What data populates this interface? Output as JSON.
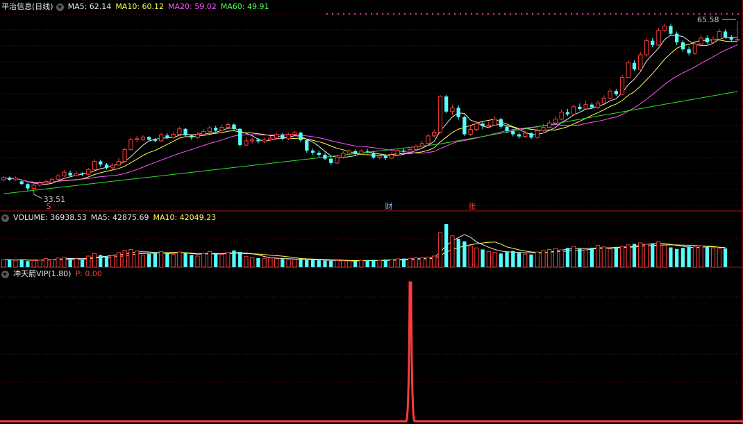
{
  "price_panel": {
    "title": "平治信息(日线)",
    "ma_labels": [
      {
        "text": "MA5: 62.14",
        "color": "#e8e8e8"
      },
      {
        "text": "MA10: 60.12",
        "color": "#ffff54"
      },
      {
        "text": "MA20: 59.02",
        "color": "#ff54ff"
      },
      {
        "text": "MA60: 49.91",
        "color": "#54ff54"
      }
    ],
    "high_label": "65.58",
    "low_label": "33.51",
    "markers": [
      {
        "text": "S",
        "color": "#ff3c3c"
      },
      {
        "text": "财",
        "color": "#8ab4ff"
      },
      {
        "text": "张",
        "color": "#ff3c3c"
      }
    ]
  },
  "volume_panel": {
    "labels": [
      {
        "text": "VOLUME: 36938.53",
        "color": "#e8e8e8"
      },
      {
        "text": "MA5: 42875.69",
        "color": "#e8e8e8"
      },
      {
        "text": "MA10: 42049.23",
        "color": "#ffff54"
      }
    ]
  },
  "indicator_panel": {
    "title": "冲天箭VIP(1.80)",
    "p_label": "P: 0.00",
    "p_color": "#ff3c3c"
  },
  "colors": {
    "up": "#ff3c3c",
    "down": "#54ffff",
    "ma5": "#e8e8e8",
    "ma10": "#ffff54",
    "ma20": "#ff54ff",
    "ma60": "#33dd33",
    "grid": "#7a1010",
    "border": "#b01010"
  },
  "chart_data": {
    "type": "candlestick",
    "y_range": [
      33.51,
      65.58
    ],
    "candles": [
      [
        36.2,
        36.6,
        36.9,
        35.9
      ],
      [
        36.6,
        36.2,
        36.8,
        36.0
      ],
      [
        36.2,
        36.5,
        36.8,
        36.0
      ],
      [
        35.9,
        35.4,
        36.1,
        35.2
      ],
      [
        35.4,
        34.6,
        35.6,
        34.2
      ],
      [
        34.6,
        35.2,
        35.5,
        33.5
      ],
      [
        35.2,
        35.6,
        36.0,
        34.9
      ],
      [
        35.6,
        35.9,
        36.2,
        35.3
      ],
      [
        35.7,
        36.3,
        36.5,
        35.5
      ],
      [
        36.3,
        36.9,
        37.3,
        36.0
      ],
      [
        36.9,
        37.6,
        38.0,
        36.7
      ],
      [
        37.5,
        37.0,
        37.9,
        36.7
      ],
      [
        37.0,
        37.4,
        37.8,
        36.8
      ],
      [
        37.4,
        37.2,
        37.6,
        36.9
      ],
      [
        37.2,
        38.1,
        38.4,
        37.0
      ],
      [
        38.1,
        39.6,
        40.0,
        37.9
      ],
      [
        39.6,
        39.0,
        39.9,
        38.6
      ],
      [
        39.0,
        38.4,
        39.3,
        38.1
      ],
      [
        38.4,
        38.9,
        39.2,
        38.1
      ],
      [
        38.9,
        39.6,
        40.2,
        38.8
      ],
      [
        39.6,
        41.8,
        42.1,
        39.4
      ],
      [
        41.8,
        43.6,
        44.0,
        41.6
      ],
      [
        43.6,
        43.8,
        44.3,
        43.2
      ],
      [
        43.6,
        44.1,
        44.4,
        43.4
      ],
      [
        44.1,
        43.6,
        44.3,
        43.3
      ],
      [
        43.6,
        43.4,
        43.9,
        43.1
      ],
      [
        43.4,
        44.5,
        44.9,
        43.2
      ],
      [
        44.4,
        44.0,
        44.8,
        43.7
      ],
      [
        44.0,
        44.6,
        45.0,
        43.8
      ],
      [
        44.6,
        45.6,
        46.0,
        44.4
      ],
      [
        45.6,
        44.4,
        45.8,
        44.2
      ],
      [
        44.4,
        44.0,
        44.6,
        43.6
      ],
      [
        44.0,
        44.6,
        45.0,
        43.8
      ],
      [
        44.6,
        45.1,
        45.6,
        44.3
      ],
      [
        45.1,
        45.8,
        46.2,
        44.9
      ],
      [
        45.8,
        45.3,
        46.2,
        45.0
      ],
      [
        45.3,
        45.9,
        46.4,
        45.1
      ],
      [
        45.9,
        46.4,
        46.8,
        45.6
      ],
      [
        46.4,
        45.6,
        46.6,
        45.3
      ],
      [
        45.6,
        42.6,
        45.8,
        42.3
      ],
      [
        42.6,
        43.4,
        44.1,
        42.4
      ],
      [
        43.4,
        43.6,
        44.0,
        42.9
      ],
      [
        43.6,
        43.3,
        43.9,
        42.9
      ],
      [
        43.3,
        43.6,
        44.0,
        43.0
      ],
      [
        43.6,
        43.9,
        44.3,
        43.3
      ],
      [
        43.9,
        44.5,
        45.0,
        43.6
      ],
      [
        44.5,
        43.8,
        44.8,
        43.5
      ],
      [
        43.8,
        44.6,
        44.9,
        43.5
      ],
      [
        44.6,
        44.9,
        45.3,
        44.4
      ],
      [
        44.9,
        43.5,
        45.1,
        43.2
      ],
      [
        43.5,
        41.6,
        43.7,
        41.2
      ],
      [
        41.6,
        41.2,
        42.0,
        40.8
      ],
      [
        41.2,
        40.8,
        41.6,
        40.4
      ],
      [
        40.8,
        40.1,
        41.2,
        39.8
      ],
      [
        40.1,
        39.3,
        40.5,
        38.9
      ],
      [
        39.3,
        40.4,
        40.8,
        39.0
      ],
      [
        40.4,
        41.1,
        41.5,
        40.1
      ],
      [
        41.1,
        41.5,
        41.9,
        40.8
      ],
      [
        41.5,
        41.0,
        41.8,
        40.7
      ],
      [
        41.0,
        41.5,
        41.8,
        40.8
      ],
      [
        41.5,
        41.4,
        41.9,
        41.1
      ],
      [
        41.2,
        40.3,
        41.5,
        40.0
      ],
      [
        40.3,
        40.6,
        41.0,
        40.0
      ],
      [
        40.6,
        40.2,
        40.9,
        39.9
      ],
      [
        40.2,
        40.8,
        41.3,
        40.0
      ],
      [
        40.8,
        41.6,
        41.9,
        40.6
      ],
      [
        41.6,
        41.5,
        41.9,
        41.2
      ],
      [
        41.5,
        41.8,
        42.1,
        41.3
      ],
      [
        41.8,
        42.4,
        42.8,
        41.6
      ],
      [
        42.4,
        42.9,
        43.4,
        42.2
      ],
      [
        42.9,
        44.3,
        44.7,
        42.7
      ],
      [
        44.3,
        45.0,
        45.5,
        44.0
      ],
      [
        45.0,
        51.6,
        51.8,
        44.8
      ],
      [
        51.6,
        48.8,
        51.9,
        48.5
      ],
      [
        48.8,
        49.5,
        50.1,
        48.2
      ],
      [
        49.5,
        47.8,
        50.0,
        47.3
      ],
      [
        47.8,
        44.6,
        48.1,
        44.3
      ],
      [
        44.6,
        45.5,
        46.2,
        44.3
      ],
      [
        45.5,
        46.6,
        47.1,
        45.2
      ],
      [
        46.6,
        46.1,
        47.0,
        45.5
      ],
      [
        46.1,
        46.3,
        46.9,
        45.8
      ],
      [
        46.3,
        47.4,
        47.9,
        46.1
      ],
      [
        47.4,
        46.0,
        47.7,
        45.6
      ],
      [
        46.0,
        45.2,
        46.3,
        44.8
      ],
      [
        45.2,
        44.6,
        45.5,
        44.2
      ],
      [
        44.6,
        44.2,
        44.9,
        43.8
      ],
      [
        44.2,
        44.8,
        45.4,
        43.9
      ],
      [
        44.8,
        44.0,
        45.0,
        43.7
      ],
      [
        44.0,
        45.3,
        45.9,
        43.8
      ],
      [
        45.3,
        45.9,
        46.5,
        45.1
      ],
      [
        45.9,
        46.7,
        47.2,
        45.7
      ],
      [
        46.7,
        47.4,
        47.9,
        46.4
      ],
      [
        47.4,
        48.7,
        49.2,
        47.2
      ],
      [
        48.7,
        48.3,
        49.3,
        48.0
      ],
      [
        48.3,
        49.7,
        50.1,
        48.1
      ],
      [
        49.7,
        49.3,
        50.3,
        49.0
      ],
      [
        49.3,
        50.1,
        50.8,
        49.1
      ],
      [
        50.1,
        49.6,
        50.5,
        49.3
      ],
      [
        49.6,
        50.4,
        50.9,
        49.3
      ],
      [
        50.4,
        51.3,
        51.8,
        50.1
      ],
      [
        51.3,
        52.6,
        53.1,
        51.1
      ],
      [
        52.6,
        52.0,
        53.0,
        51.7
      ],
      [
        52.0,
        55.1,
        55.6,
        51.8
      ],
      [
        55.1,
        57.8,
        58.3,
        54.9
      ],
      [
        57.8,
        56.6,
        58.3,
        56.3
      ],
      [
        56.6,
        59.3,
        59.8,
        56.4
      ],
      [
        59.3,
        61.9,
        62.4,
        59.0
      ],
      [
        61.9,
        61.1,
        62.4,
        60.7
      ],
      [
        61.1,
        63.8,
        64.3,
        60.9
      ],
      [
        63.8,
        64.6,
        65.1,
        63.5
      ],
      [
        64.6,
        63.2,
        65.0,
        62.8
      ],
      [
        63.2,
        61.6,
        63.6,
        61.1
      ],
      [
        61.6,
        60.3,
        62.0,
        59.9
      ],
      [
        60.3,
        59.6,
        60.8,
        59.2
      ],
      [
        59.6,
        61.3,
        61.9,
        59.3
      ],
      [
        61.3,
        62.4,
        62.9,
        61.0
      ],
      [
        62.4,
        61.6,
        62.9,
        61.3
      ],
      [
        61.6,
        62.2,
        62.7,
        61.3
      ],
      [
        62.2,
        63.6,
        64.1,
        61.9
      ],
      [
        63.6,
        62.6,
        64.0,
        62.3
      ],
      [
        62.6,
        62.1,
        63.0,
        61.8
      ],
      [
        62.1,
        62.14,
        65.58,
        61.8
      ]
    ],
    "volume": [
      15000,
      14000,
      13500,
      15500,
      12000,
      13000,
      14000,
      17000,
      15500,
      18000,
      20000,
      16000,
      16500,
      14000,
      22000,
      27000,
      24000,
      21000,
      23000,
      29000,
      33000,
      35000,
      32000,
      24000,
      26000,
      28000,
      31000,
      27000,
      25000,
      30000,
      28000,
      24000,
      22000,
      27000,
      31000,
      26000,
      25000,
      29000,
      33000,
      30000,
      21000,
      19000,
      18000,
      17500,
      18000,
      16500,
      16000,
      15500,
      15000,
      15000,
      14000,
      14500,
      13500,
      13000,
      12500,
      13000,
      12500,
      12000,
      12000,
      13500,
      14000,
      14500,
      13500,
      15000,
      15500,
      16500,
      17000,
      17500,
      18500,
      19000,
      20000,
      22000,
      68000,
      85000,
      62000,
      56000,
      51000,
      42000,
      38000,
      35000,
      31000,
      29000,
      27000,
      30000,
      32000,
      28000,
      26000,
      25000,
      30000,
      33000,
      35000,
      37000,
      34000,
      38000,
      41000,
      36000,
      34000,
      38000,
      43000,
      40000,
      36000,
      39000,
      41000,
      44000,
      46000,
      48000,
      45000,
      47000,
      50000,
      43000,
      39000,
      36000,
      38000,
      41000,
      40000,
      42000,
      40000,
      38000,
      36938.53,
      37000
    ],
    "volume_range": [
      0,
      85000
    ],
    "indicator": {
      "name": "P",
      "values_note": "zero except one spike",
      "spike_index": 69,
      "spike_value": 1.0,
      "baseline": 0.0
    }
  }
}
